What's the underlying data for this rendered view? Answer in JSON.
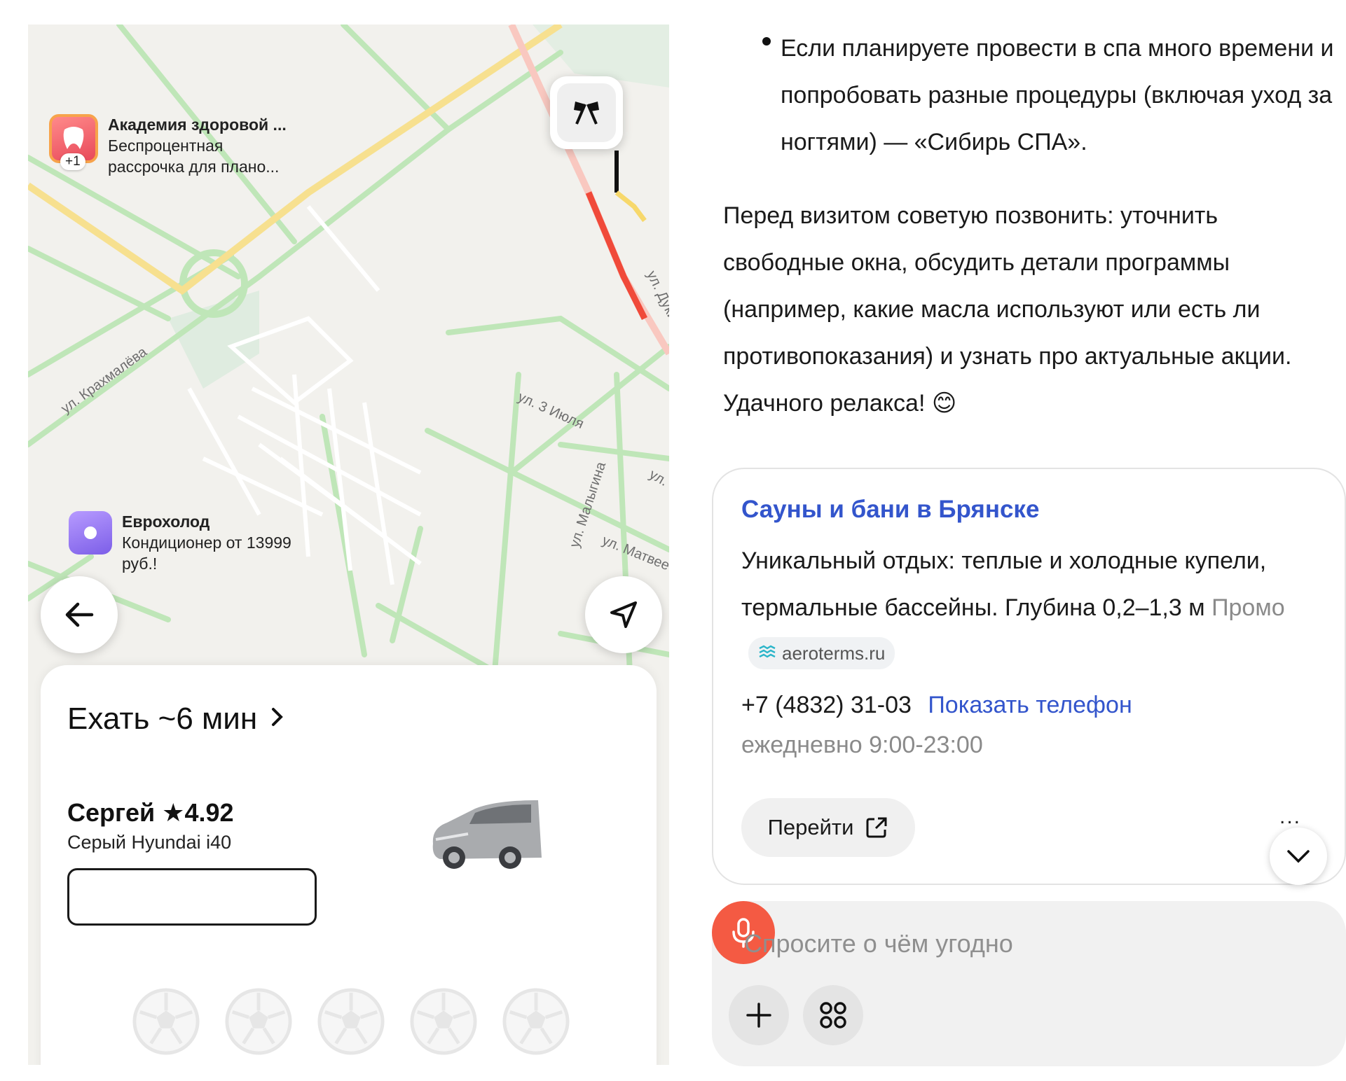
{
  "map": {
    "poi_academy": {
      "title": "Академия здоровой ...",
      "line1": "Беспроцентная",
      "line2": "рассрочка для плано...",
      "badge": "+1",
      "icon": "tooth-icon"
    },
    "poi_euro": {
      "title": "Еврохолод",
      "line1": "Кондиционер от 13999",
      "line2": "руб.!",
      "icon": "dot-icon"
    },
    "streets": {
      "krakhmaleva": "ул. Крахмалёва",
      "iyulya": "ул. 3 Июля",
      "malygina": "ул. Малыгина",
      "matveeva": "ул. Матвее",
      "duki": "ул. Дуки",
      "ul": "ул."
    },
    "buttons": {
      "back_icon": "arrow-left-icon",
      "locate_icon": "navigation-arrow-icon",
      "finish_icon": "finish-flags-icon"
    }
  },
  "ride": {
    "eta": "Ехать ~6 мин",
    "driver_name": "Сергей",
    "driver_rating": "★4.92",
    "car": "Серый Hyundai i40",
    "rating_icons": 5
  },
  "chat": {
    "bullet_text": "Если планируете провести в спа много времени и попробовать разные процедуры (включая уход за ногтями) — «Сибирь СПА».",
    "advice_text": "Перед визитом советую позвонить: уточнить свободные окна, обсудить детали программы (например, какие масла используют или есть ли противопоказания) и узнать про актуальные акции. Удачного релакса! 😊",
    "ad": {
      "title": "Сауны и бани в Брянске",
      "description": "Уникальный отдых: теплые и холодные купели, термальные бассейны. Глубина 0,2–1,3 м",
      "promo_label": "Промо",
      "domain": "aeroterms.ru",
      "phone": "+7 (4832) 31-03",
      "show_phone": "Показать телефон",
      "hours": "ежедневно 9:00-23:00",
      "go_button": "Перейти",
      "more": "..."
    },
    "input": {
      "placeholder": "Спросите о чём угодно"
    }
  },
  "colors": {
    "link_blue": "#3355cc",
    "mic_red": "#f45a43",
    "traffic_red": "#f04a3a"
  }
}
